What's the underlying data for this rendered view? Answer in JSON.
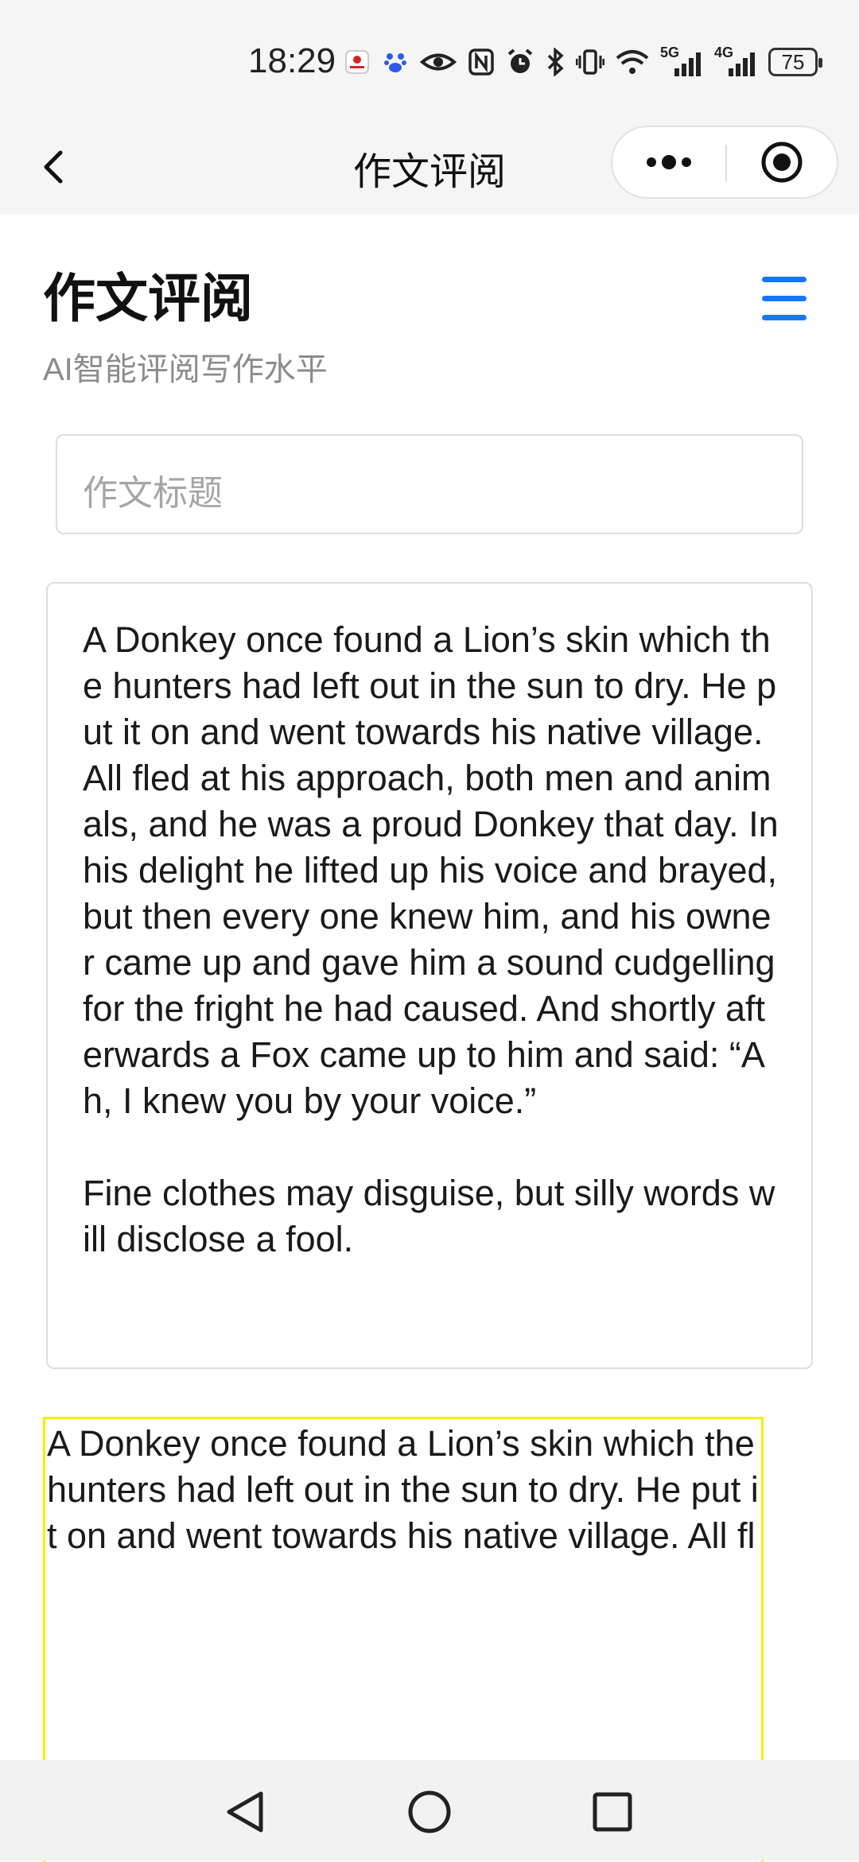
{
  "status_bar": {
    "time": "18:29",
    "icons": [
      "huawei-app-icon",
      "baidu-icon",
      "eye-icon",
      "nfc-icon",
      "alarm-icon",
      "bluetooth-icon",
      "vibrate-icon",
      "wifi-icon",
      "5g-signal-icon",
      "4g-signal-icon"
    ],
    "network_5g": "5G",
    "network_4g": "4G",
    "battery": "75"
  },
  "navbar": {
    "title": "作文评阅",
    "back_icon": "chevron-left-icon",
    "more_icon": "more-dots-icon",
    "close_icon": "target-circle-icon"
  },
  "header": {
    "title": "作文评阅",
    "subtitle": "AI智能评阅写作水平",
    "menu_icon": "hamburger-menu-icon",
    "accent_color": "#1677ff"
  },
  "form": {
    "title_placeholder": "作文标题",
    "essay_text": "A Donkey once found a Lion’s skin which the hunters had left out in the sun to dry. He put it on and went towards his native village. All fled at his approach, both men and animals, and he was a proud Donkey that day. In his delight he lifted up his voice and brayed, but then every one knew him, and his owner came up and gave him a sound cudgelling for the fright he had caused. And shortly afterwards a Fox came up to him and said: “Ah, I knew you by your voice.”\n\nFine clothes may disguise, but silly words will disclose a fool.",
    "preview_text": "A Donkey once found a Lion’s skin which the hunters had left out in the sun to dry. He put it on and went towards his native village. All fl",
    "preview_border_color": "#f2f200"
  },
  "system_nav": {
    "back_icon": "triangle-back-icon",
    "home_icon": "circle-home-icon",
    "recents_icon": "square-recents-icon"
  }
}
